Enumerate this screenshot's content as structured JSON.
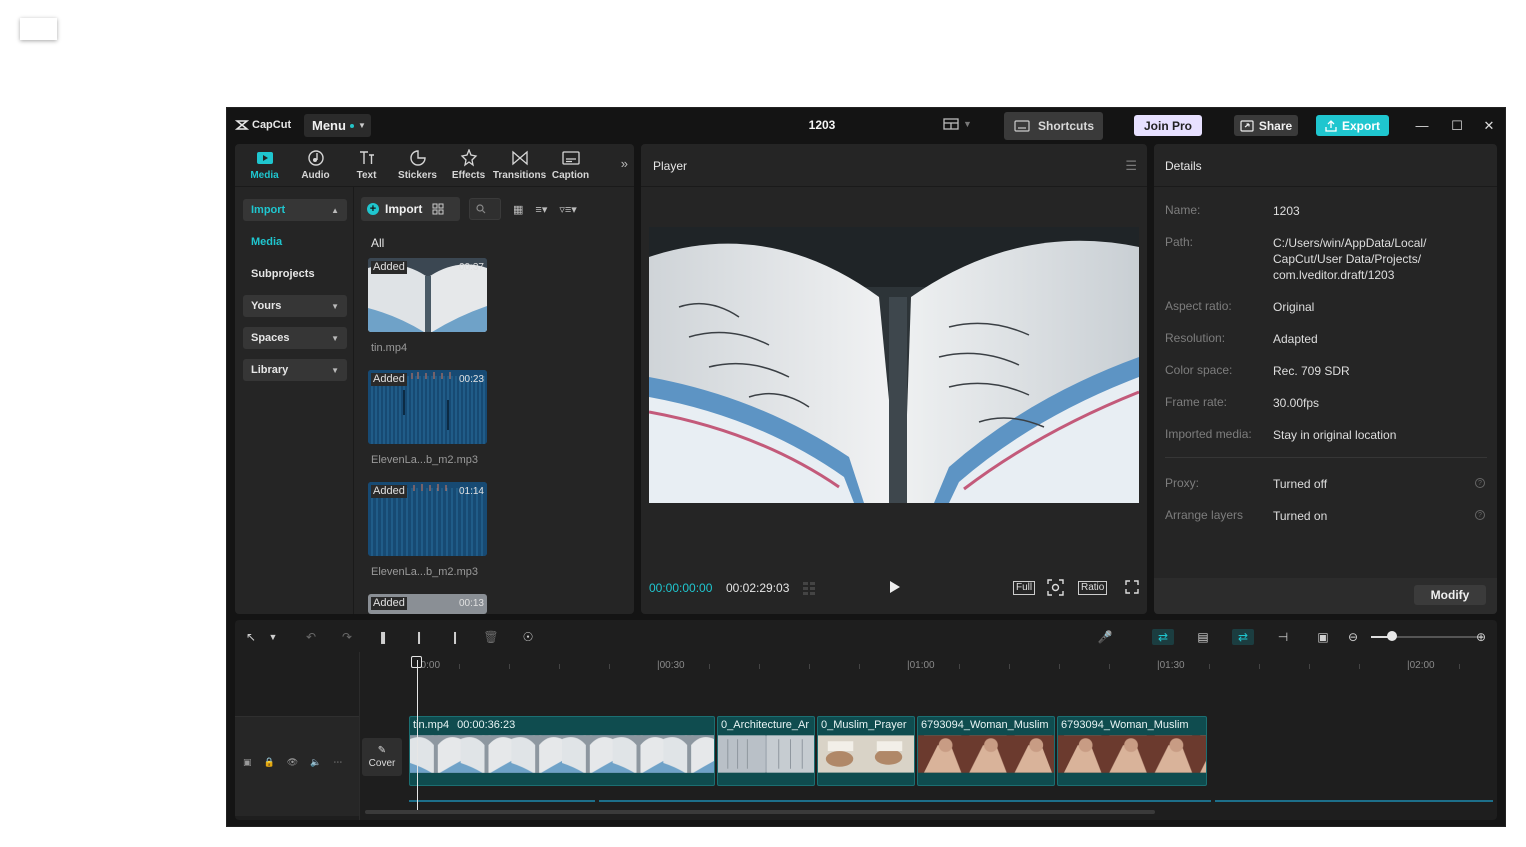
{
  "app": {
    "logo_text": "CapCut",
    "menu_label": "Menu",
    "project_title": "1203",
    "shortcuts_label": "Shortcuts",
    "join_pro_label": "Join Pro",
    "share_label": "Share",
    "export_label": "Export",
    "accent_color": "#1fc6cf"
  },
  "tabs": [
    {
      "label": "Media",
      "icon": "media-icon",
      "active": true
    },
    {
      "label": "Audio",
      "icon": "audio-icon"
    },
    {
      "label": "Text",
      "icon": "text-icon"
    },
    {
      "label": "Stickers",
      "icon": "sticker-icon"
    },
    {
      "label": "Effects",
      "icon": "effects-icon"
    },
    {
      "label": "Transitions",
      "icon": "transitions-icon"
    },
    {
      "label": "Caption",
      "icon": "caption-icon"
    }
  ],
  "sidebar": {
    "import": "Import",
    "media": "Media",
    "subprojects": "Subprojects",
    "yours": "Yours",
    "spaces": "Spaces",
    "library": "Library"
  },
  "media_toolbar": {
    "import_label": "Import",
    "filter_label": "All"
  },
  "media_items": [
    {
      "badge": "Added",
      "duration": "00:37",
      "name": "tin.mp4"
    },
    {
      "badge": "Added",
      "duration": "00:23",
      "name": "ElevenLa...b_m2.mp3"
    },
    {
      "badge": "Added",
      "duration": "01:14",
      "name": "ElevenLa...b_m2.mp3"
    },
    {
      "badge": "Added",
      "duration": "00:13",
      "name": ""
    }
  ],
  "player": {
    "title": "Player",
    "current_time": "00:00:00:00",
    "total_time": "00:02:29:03",
    "full_label": "Full",
    "ratio_label": "Ratio"
  },
  "details": {
    "title": "Details",
    "rows": [
      {
        "label": "Name:",
        "value": "1203"
      },
      {
        "label": "Path:",
        "value": "C:/Users/win/AppData/Local/ CapCut/User Data/Projects/ com.lveditor.draft/1203"
      },
      {
        "label": "Aspect ratio:",
        "value": "Original"
      },
      {
        "label": "Resolution:",
        "value": "Adapted"
      },
      {
        "label": "Color space:",
        "value": "Rec. 709 SDR"
      },
      {
        "label": "Frame rate:",
        "value": "30.00fps"
      },
      {
        "label": "Imported media:",
        "value": "Stay in original location"
      }
    ],
    "proxy_label": "Proxy:",
    "proxy_value": "Turned off",
    "arrange_label": "Arrange layers",
    "arrange_value": "Turned on",
    "modify_label": "Modify"
  },
  "timeline": {
    "ruler": [
      "00:00",
      "|00:30",
      "|01:00",
      "|01:30",
      "|02:00"
    ],
    "cover_label": "Cover",
    "clips": [
      {
        "name": "tin.mp4",
        "duration": "00:00:36:23"
      },
      {
        "name": "0_Architecture_Ar",
        "duration": ""
      },
      {
        "name": "0_Muslim_Prayer",
        "duration": ""
      },
      {
        "name": "6793094_Woman_Muslim",
        "duration": ""
      },
      {
        "name": "6793094_Woman_Muslim",
        "duration": ""
      }
    ]
  }
}
